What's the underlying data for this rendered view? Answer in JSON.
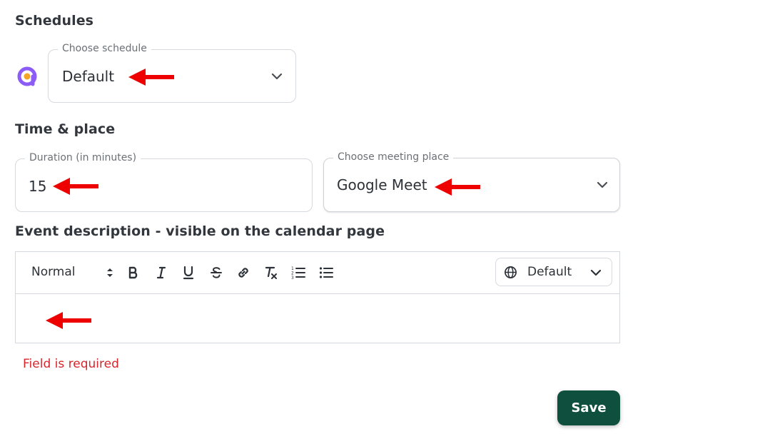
{
  "schedules": {
    "title": "Schedules",
    "schedule_field": {
      "legend": "Choose schedule",
      "value": "Default"
    },
    "app_icon": "brand-logo-icon"
  },
  "time_place": {
    "title": "Time & place",
    "duration": {
      "legend": "Duration (in minutes)",
      "value": "15"
    },
    "meeting_place": {
      "legend": "Choose meeting place",
      "value": "Google Meet"
    }
  },
  "description": {
    "title": "Event description - visible on the calendar page",
    "toolbar": {
      "style_select": "Normal",
      "buttons": [
        "bold",
        "italic",
        "underline",
        "strikethrough",
        "link",
        "clear-format",
        "ordered-list",
        "bullet-list"
      ],
      "language_select": "Default"
    },
    "body_value": ""
  },
  "error_message": "Field is required",
  "save_label": "Save",
  "colors": {
    "accent": "#0e4f3d",
    "error": "#d7262c",
    "annotation_arrow": "#ee0000",
    "logo": "#8b5cf6"
  }
}
